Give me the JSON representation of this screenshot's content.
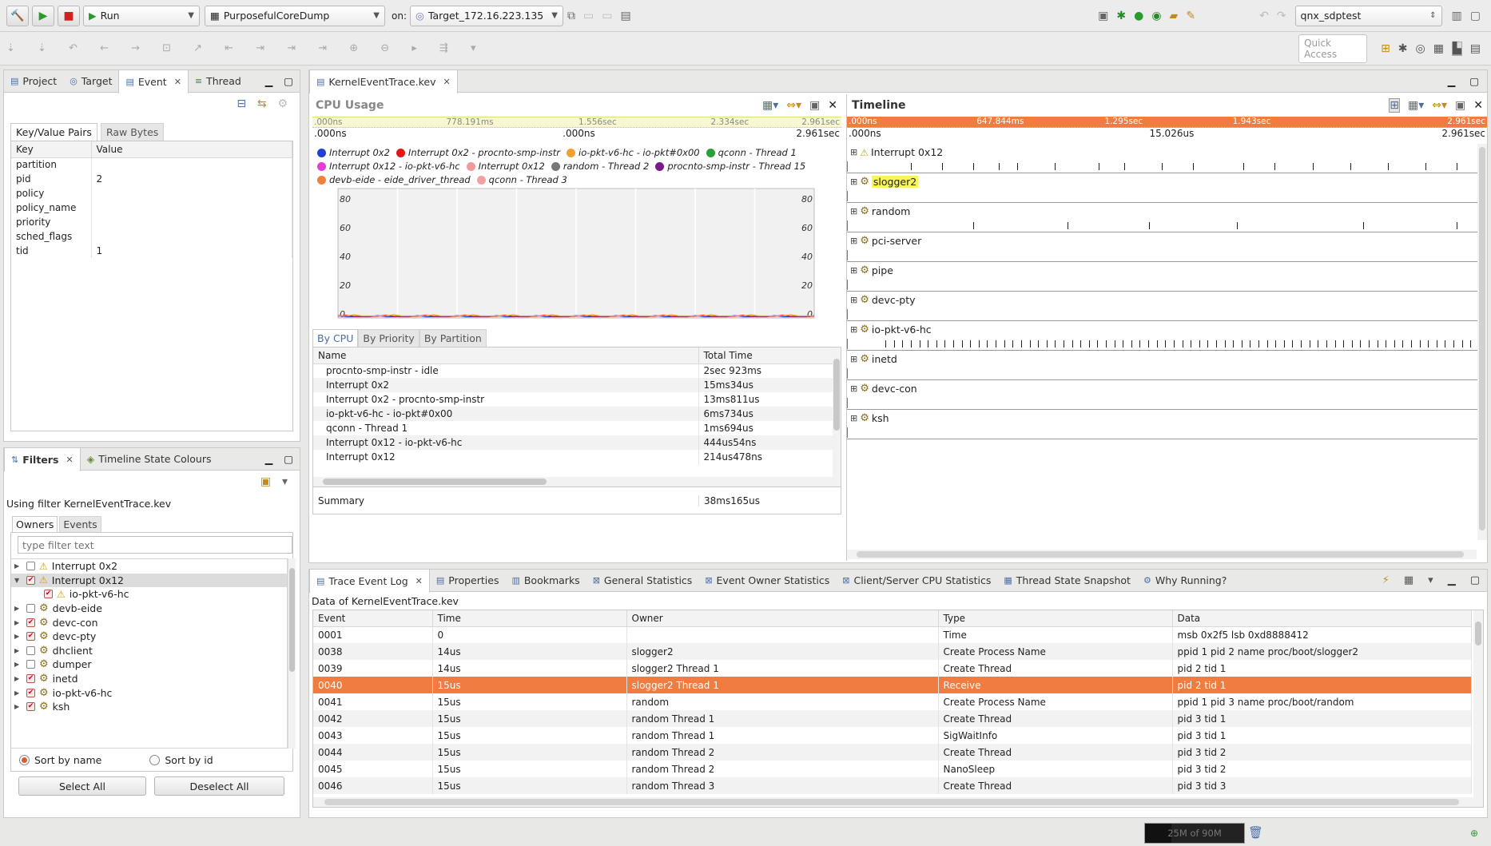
{
  "toolbar": {
    "run_mode": "Run",
    "launch_config": "PurposefulCoreDump",
    "on_label": "on:",
    "target": "Target_172.16.223.135",
    "workspace": "qnx_sdptest",
    "quick_access": "Quick Access"
  },
  "left_top": {
    "tabs": [
      "Project",
      "Target",
      "Event",
      "Thread"
    ],
    "subtabs": [
      "Key/Value Pairs",
      "Raw Bytes"
    ],
    "columns": [
      "Key",
      "Value"
    ],
    "rows": [
      {
        "key": "partition",
        "value": ""
      },
      {
        "key": "pid",
        "value": "2"
      },
      {
        "key": "policy",
        "value": ""
      },
      {
        "key": "policy_name",
        "value": ""
      },
      {
        "key": "priority",
        "value": ""
      },
      {
        "key": "sched_flags",
        "value": ""
      },
      {
        "key": "tid",
        "value": "1"
      }
    ]
  },
  "filters": {
    "tabs": [
      "Filters",
      "Timeline State Colours"
    ],
    "using": "Using filter KernelEventTrace.kev",
    "subtabs": [
      "Owners",
      "Events"
    ],
    "placeholder": "type filter text",
    "tree": [
      {
        "label": "Interrupt 0x2",
        "checked": false,
        "type": "warn",
        "expand": "▶",
        "indent": 0
      },
      {
        "label": "Interrupt 0x12",
        "checked": true,
        "type": "warn",
        "expand": "▼",
        "indent": 0,
        "sel": true
      },
      {
        "label": "io-pkt-v6-hc",
        "checked": true,
        "type": "warn",
        "expand": "",
        "indent": 1
      },
      {
        "label": "devb-eide",
        "checked": false,
        "type": "gear",
        "expand": "▶",
        "indent": 0
      },
      {
        "label": "devc-con",
        "checked": true,
        "type": "gear",
        "expand": "▶",
        "indent": 0
      },
      {
        "label": "devc-pty",
        "checked": true,
        "type": "gear",
        "expand": "▶",
        "indent": 0
      },
      {
        "label": "dhclient",
        "checked": false,
        "type": "gear",
        "expand": "▶",
        "indent": 0
      },
      {
        "label": "dumper",
        "checked": false,
        "type": "gear",
        "expand": "▶",
        "indent": 0
      },
      {
        "label": "inetd",
        "checked": true,
        "type": "gear",
        "expand": "▶",
        "indent": 0
      },
      {
        "label": "io-pkt-v6-hc",
        "checked": true,
        "type": "gear",
        "expand": "▶",
        "indent": 0
      },
      {
        "label": "ksh",
        "checked": true,
        "type": "gear",
        "expand": "▶",
        "indent": 0
      }
    ],
    "sort_by_name": "Sort by name",
    "sort_by_id": "Sort by id",
    "select_all": "Select All",
    "deselect_all": "Deselect All"
  },
  "editor": {
    "tab": "KernelEventTrace.kev"
  },
  "cpu": {
    "title": "CPU Usage",
    "ruler_top": [
      ".000ns",
      "778.191ms",
      "1.556sec",
      "2.334sec",
      "2.961sec"
    ],
    "ruler_bottom": [
      ".000ns",
      ".000ns",
      "2.961sec"
    ],
    "legend": [
      {
        "label": "Interrupt 0x2",
        "color": "#1f3fd6"
      },
      {
        "label": "Interrupt 0x2 - procnto-smp-instr",
        "color": "#e01818"
      },
      {
        "label": "io-pkt-v6-hc - io-pkt#0x00",
        "color": "#f0a030"
      },
      {
        "label": "qconn - Thread 1",
        "color": "#2c9e3a"
      },
      {
        "label": "Interrupt 0x12 - io-pkt-v6-hc",
        "color": "#e83ad8"
      },
      {
        "label": "Interrupt 0x12",
        "color": "#f29a9a"
      },
      {
        "label": "random - Thread 2",
        "color": "#777777"
      },
      {
        "label": "procnto-smp-instr - Thread 15",
        "color": "#7a1a8a"
      },
      {
        "label": "devb-eide - eide_driver_thread",
        "color": "#f08040"
      },
      {
        "label": "qconn - Thread 3",
        "color": "#f4a0a0"
      }
    ],
    "yticks": [
      "80",
      "60",
      "40",
      "20",
      "0"
    ],
    "subtabs": [
      "By CPU",
      "By Priority",
      "By Partition"
    ],
    "columns": [
      "Name",
      "Total Time"
    ],
    "rows": [
      {
        "name": "procnto-smp-instr - idle",
        "time": "2sec 923ms"
      },
      {
        "name": "Interrupt 0x2",
        "time": "15ms34us"
      },
      {
        "name": "Interrupt 0x2 - procnto-smp-instr",
        "time": "13ms811us"
      },
      {
        "name": "io-pkt-v6-hc - io-pkt#0x00",
        "time": "6ms734us"
      },
      {
        "name": "qconn - Thread 1",
        "time": "1ms694us"
      },
      {
        "name": "Interrupt 0x12 - io-pkt-v6-hc",
        "time": "444us54ns"
      },
      {
        "name": "Interrupt 0x12",
        "time": "214us478ns"
      }
    ],
    "summary_label": "Summary",
    "summary_value": "38ms165us"
  },
  "timeline": {
    "title": "Timeline",
    "ruler_top": [
      ".000ns",
      "647.844ms",
      "1.295sec",
      "1.943sec",
      "2.961sec"
    ],
    "ruler_bottom": [
      ".000ns",
      "15.026us",
      "2.961sec"
    ],
    "rows": [
      {
        "label": "Interrupt 0x12",
        "type": "warn"
      },
      {
        "label": "slogger2",
        "type": "gear",
        "highlight": true
      },
      {
        "label": "random",
        "type": "gear"
      },
      {
        "label": "pci-server",
        "type": "gear"
      },
      {
        "label": "pipe",
        "type": "gear"
      },
      {
        "label": "devc-pty",
        "type": "gear"
      },
      {
        "label": "io-pkt-v6-hc",
        "type": "gear"
      },
      {
        "label": "inetd",
        "type": "gear"
      },
      {
        "label": "devc-con",
        "type": "gear"
      },
      {
        "label": "ksh",
        "type": "gear"
      }
    ]
  },
  "bottom": {
    "tabs": [
      "Trace Event Log",
      "Properties",
      "Bookmarks",
      "General Statistics",
      "Event Owner Statistics",
      "Client/Server CPU Statistics",
      "Thread State Snapshot",
      "Why Running?"
    ],
    "caption": "Data of KernelEventTrace.kev",
    "columns": [
      "Event",
      "Time",
      "Owner",
      "Type",
      "Data"
    ],
    "rows": [
      {
        "event": "0001",
        "time": "0",
        "owner": "",
        "type": "Time",
        "data": "msb 0x2f5 lsb 0xd8888412"
      },
      {
        "event": "0038",
        "time": "14us",
        "owner": "slogger2",
        "type": "Create Process Name",
        "data": "ppid 1 pid 2 name proc/boot/slogger2"
      },
      {
        "event": "0039",
        "time": "14us",
        "owner": "slogger2 Thread 1",
        "type": "Create Thread",
        "data": "pid 2 tid 1"
      },
      {
        "event": "0040",
        "time": "15us",
        "owner": "slogger2 Thread 1",
        "type": "Receive",
        "data": "pid 2 tid 1",
        "selected": true
      },
      {
        "event": "0041",
        "time": "15us",
        "owner": "random",
        "type": "Create Process Name",
        "data": "ppid 1 pid 3 name proc/boot/random"
      },
      {
        "event": "0042",
        "time": "15us",
        "owner": "random Thread 1",
        "type": "Create Thread",
        "data": "pid 3 tid 1"
      },
      {
        "event": "0043",
        "time": "15us",
        "owner": "random Thread 1",
        "type": "SigWaitInfo",
        "data": "pid 3 tid 1"
      },
      {
        "event": "0044",
        "time": "15us",
        "owner": "random Thread 2",
        "type": "Create Thread",
        "data": "pid 3 tid 2"
      },
      {
        "event": "0045",
        "time": "15us",
        "owner": "random Thread 2",
        "type": "NanoSleep",
        "data": "pid 3 tid 2"
      },
      {
        "event": "0046",
        "time": "15us",
        "owner": "random Thread 3",
        "type": "Create Thread",
        "data": "pid 3 tid 3"
      }
    ]
  },
  "status": {
    "heap": "25M of 90M"
  }
}
